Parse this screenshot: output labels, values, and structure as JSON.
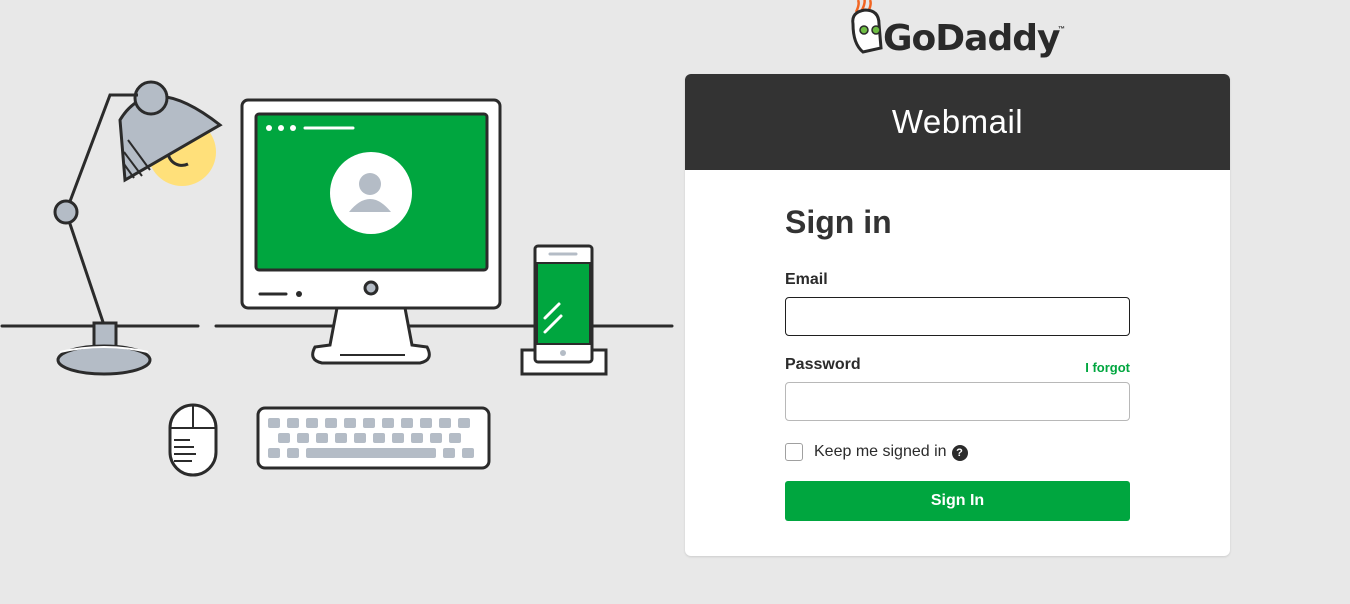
{
  "brand": {
    "name": "GoDaddy",
    "trademark": "™"
  },
  "header": {
    "title": "Webmail"
  },
  "form": {
    "title": "Sign in",
    "email_label": "Email",
    "email_value": "",
    "password_label": "Password",
    "password_value": "",
    "forgot_label": "I forgot",
    "keep_signed_in_label": "Keep me signed in",
    "keep_signed_in_checked": false,
    "help_icon": "?",
    "submit_label": "Sign In"
  },
  "colors": {
    "accent_green": "#00a63f",
    "header_dark": "#333333",
    "page_background": "#e8e8e8",
    "lamp_grey": "#b4bcc6",
    "lamp_light": "#ffe07a"
  },
  "icons": [
    "lamp-icon",
    "monitor-icon",
    "user-avatar-icon",
    "phone-icon",
    "mouse-icon",
    "keyboard-icon",
    "godaddy-logo",
    "help-icon"
  ]
}
